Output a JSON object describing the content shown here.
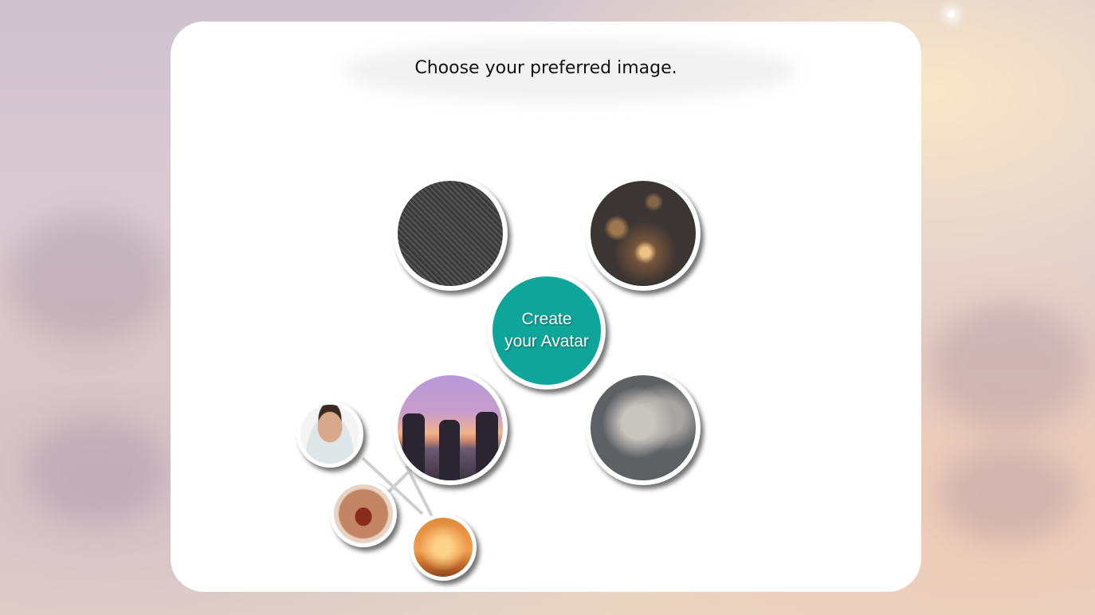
{
  "page": {
    "title": "Choose your preferred image."
  },
  "center_button": {
    "line1": "Create",
    "line2": "your Avatar",
    "color": "#0fa59a"
  },
  "images": [
    {
      "id": "lace",
      "icon": "lace-texture-image"
    },
    {
      "id": "candle",
      "icon": "candle-image"
    },
    {
      "id": "friends-sunset",
      "icon": "friends-sunset-image"
    },
    {
      "id": "angel",
      "icon": "angel-warrior-image"
    }
  ],
  "sub_images": [
    {
      "id": "smiling-man",
      "icon": "smiling-man-image"
    },
    {
      "id": "laughing-man",
      "icon": "laughing-man-image"
    },
    {
      "id": "couple-sunset",
      "icon": "couple-sunset-image"
    }
  ]
}
